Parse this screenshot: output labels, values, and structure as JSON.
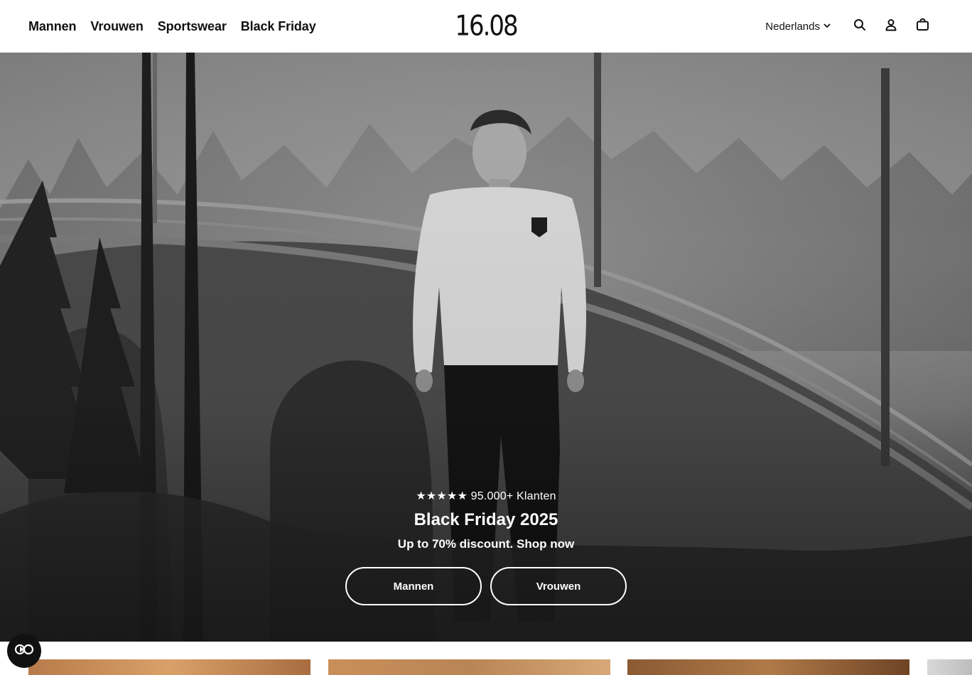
{
  "nav": {
    "items": [
      {
        "label": "Mannen"
      },
      {
        "label": "Vrouwen"
      },
      {
        "label": "Sportswear"
      },
      {
        "label": "Black Friday"
      }
    ]
  },
  "logo": {
    "text": "16.08"
  },
  "header": {
    "language": "Nederlands",
    "icons": [
      "search-icon",
      "account-icon",
      "cart-icon",
      "chevron-down-icon"
    ]
  },
  "hero": {
    "rating": "★★★★★ 95.000+ Klanten",
    "title": "Black Friday 2025",
    "subtitle": "Up to 70% discount. Shop now",
    "buttons": [
      {
        "label": "Mannen"
      },
      {
        "label": "Vrouwen"
      }
    ]
  },
  "accessibility": {
    "icon": "accessibility-toggle-icon"
  },
  "colors": {
    "text": "#111111",
    "background": "#ffffff",
    "hero_overlay": "#4a4a4a"
  }
}
